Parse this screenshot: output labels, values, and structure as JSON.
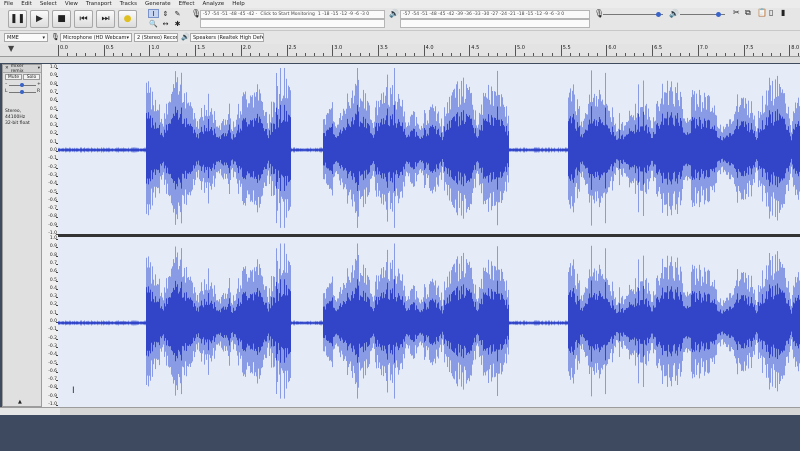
{
  "app": {
    "name": "Audacity"
  },
  "menu": [
    "File",
    "Edit",
    "Select",
    "View",
    "Transport",
    "Tracks",
    "Generate",
    "Effect",
    "Analyze",
    "Help"
  ],
  "transport": {
    "pause": "pause-icon",
    "play": "play-icon",
    "stop": "stop-icon",
    "skip_start": "skip-start-icon",
    "skip_end": "skip-end-icon",
    "record": "record-icon"
  },
  "meters": {
    "record_scale": "-57 -54 -51 -48 -45 -42 -",
    "record_prompt": "Click to Start Monitoring",
    "record_scale_tail": "1 -18 -15 -12  -9  -6  -3  0",
    "playback_scale": "-57 -54 -51 -48 -45 -42 -39 -36 -33 -30 -27 -24 -21 -18 -15 -12  -9  -6  -3  0"
  },
  "devices": {
    "host": "MME",
    "input": "Microphone (HD Webcam",
    "channels": "2 (Stereo) Recor",
    "output": "Speakers (Realtek High Def"
  },
  "ruler": {
    "labels": [
      "0.0",
      "0.5",
      "1.0",
      "1.5",
      "2.0",
      "2.5",
      "3.0",
      "3.5",
      "4.0",
      "4.5",
      "5.0",
      "5.5",
      "6.0",
      "6.5",
      "7.0",
      "7.5",
      "8.0"
    ]
  },
  "track": {
    "name": "mixer remix",
    "mute": "Mute",
    "solo": "Solo",
    "info_line1": "Stereo, 44100Hz",
    "info_line2": "32-bit float",
    "scale": [
      "1.0",
      "0.9",
      "0.8",
      "0.7",
      "0.6",
      "0.5",
      "0.4",
      "0.3",
      "0.2",
      "0.1",
      "0.0",
      "-0.1",
      "-0.2",
      "-0.3",
      "-0.4",
      "-0.5",
      "-0.6",
      "-0.7",
      "-0.8",
      "-0.9",
      "-1.0"
    ],
    "wave_color": "#3245c9",
    "wave_light": "#8a9be6",
    "bg_color": "#e5ecf8"
  }
}
